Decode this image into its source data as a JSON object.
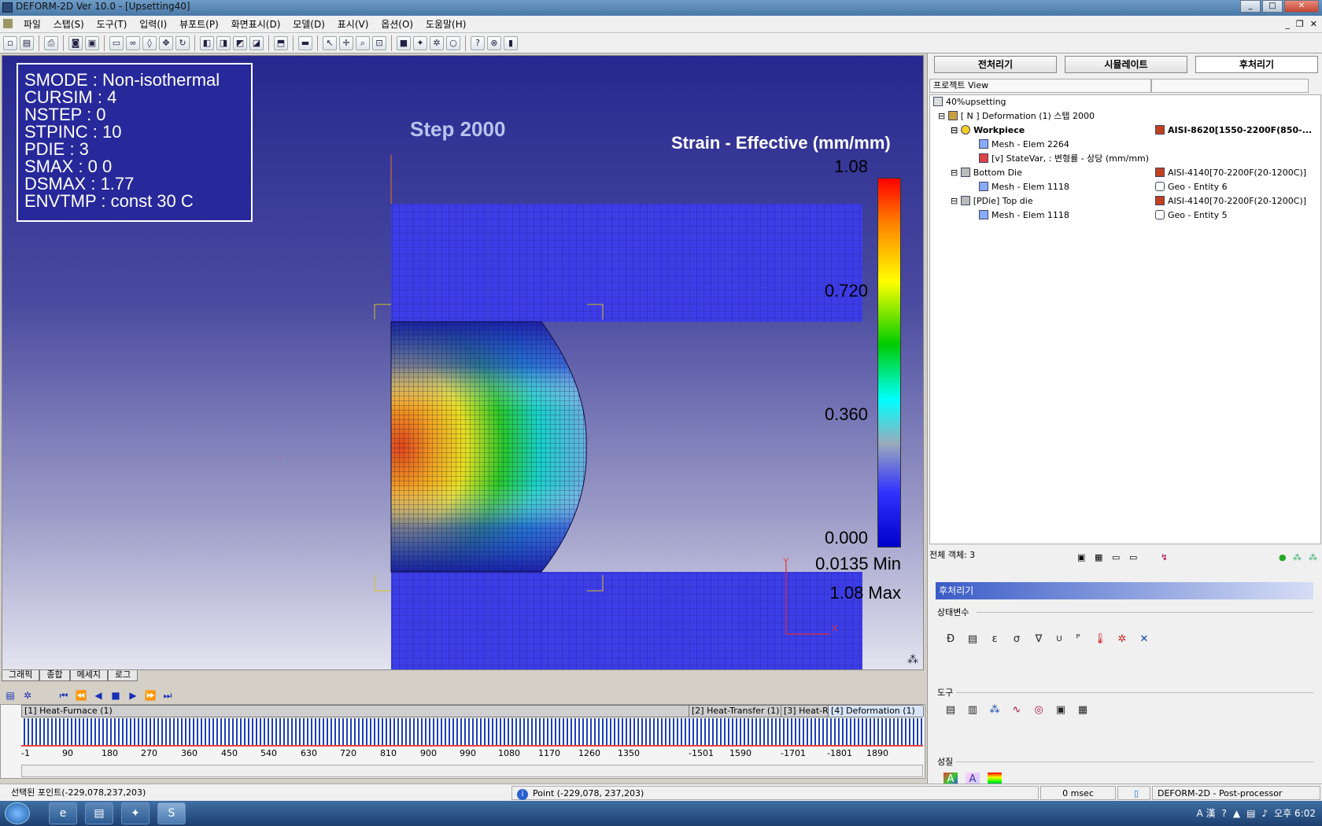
{
  "window": {
    "title": "DEFORM-2D  Ver 10.0 - [Upsetting40]"
  },
  "menu": [
    "파일",
    "스탭(S)",
    "도구(T)",
    "입력(I)",
    "뷰포트(P)",
    "화면표시(D)",
    "모델(D)",
    "표시(V)",
    "옵션(O)",
    "도움말(H)"
  ],
  "viewport": {
    "info_lines": [
      "SMODE :  Non-isothermal",
      "CURSIM :  4",
      "NSTEP : 0",
      "STPINC : 10",
      "PDIE : 3",
      "SMAX : 0  0",
      "DSMAX : 1.77",
      "ENVTMP : const 30 C"
    ],
    "step_label": "Step 2000",
    "colorbar_title": "Strain - Effective (mm/mm)",
    "colorbar_ticks": [
      "1.08",
      "0.720",
      "0.360",
      "0.000"
    ],
    "min_label": "0.0135 Min",
    "max_label": "1.08 Max",
    "axis_y": "Y",
    "axis_x": "X",
    "colors": {
      "mesh": "#3a3ae6",
      "background_top": "#27288f"
    }
  },
  "view_tabs": [
    "그래픽",
    "종합",
    "메세지",
    "로그"
  ],
  "timeline": {
    "segments": [
      "[1] Heat-Furnace (1)",
      "[2] Heat-Transfer (1)",
      "[3] Heat-R",
      "[4] Deformation (1)"
    ],
    "ticks": [
      "-1",
      "90",
      "180",
      "270",
      "360",
      "450",
      "540",
      "630",
      "720",
      "810",
      "900",
      "990",
      "1080",
      "1170",
      "1260",
      "1350",
      "-1501",
      "1590",
      "-1701",
      "-1801",
      "1890"
    ]
  },
  "right_panel": {
    "tabs": [
      "전처리기",
      "시뮬레이트",
      "후처리기"
    ],
    "tree_header": "프로젝트 View",
    "tree": [
      {
        "label": "40%upsetting",
        "value": ""
      },
      {
        "label": "[ N ]  Deformation (1)  스탭 2000",
        "value": ""
      },
      {
        "label": "Workpiece",
        "value": "AISI-8620[1550-2200F(850-..."
      },
      {
        "label": "Mesh - Elem 2264",
        "value": ""
      },
      {
        "label": "[v] StateVar, : 변형률 - 상당 (mm/mm)",
        "value": ""
      },
      {
        "label": "Bottom Die",
        "value": "AISI-4140[70-2200F(20-1200C)]"
      },
      {
        "label": "Mesh - Elem 1118",
        "value": "Geo - Entity 6"
      },
      {
        "label": "[PDie] Top die",
        "value": "AISI-4140[70-2200F(20-1200C)]"
      },
      {
        "label": "Mesh - Elem 1118",
        "value": "Geo - Entity 5"
      }
    ],
    "object_count": "전체 객체: 3",
    "post_title": "후처리기",
    "group_state": "상태변수",
    "group_tools": "도구",
    "group_props": "성질"
  },
  "status": {
    "selected_point": "선택된 포인트(-229,078,237,203)",
    "point": "Point (-229,078, 237,203)",
    "time": "0 msec",
    "app": "DEFORM-2D  -  Post-processor"
  },
  "taskbar": {
    "clock": "오후 6:02",
    "ime": "A 漢"
  }
}
